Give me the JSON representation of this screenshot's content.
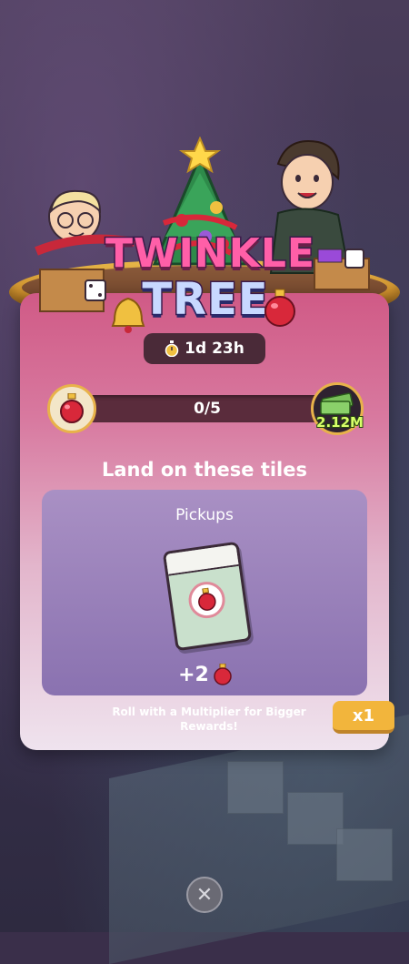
{
  "event": {
    "title_line1": "TWINKLE",
    "title_line2": "TREE",
    "timer": "1d 23h"
  },
  "progress": {
    "text": "0/5",
    "current": 0,
    "max": 5,
    "reward": "2.12M"
  },
  "tiles": {
    "heading": "Land on these tiles",
    "label": "Pickups",
    "amount": "+2"
  },
  "multiplier": {
    "hint": "Roll with a Multiplier for Bigger Rewards!",
    "button": "x1"
  },
  "icons": {
    "ornament": "ornament-icon",
    "stopwatch": "stopwatch-icon",
    "cash": "cash-stack-icon",
    "close": "close-icon"
  },
  "colors": {
    "accent": "#e8b24a",
    "ornament_red": "#d8283a",
    "panel_top": "#d05a86"
  }
}
